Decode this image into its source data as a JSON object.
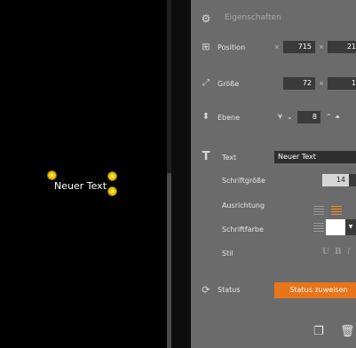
{
  "canvas": {
    "text_element": "Neuer Text"
  },
  "panel": {
    "title": "Eigenschaften",
    "position": {
      "label": "Position",
      "sep": "×",
      "x": "715",
      "y": "21"
    },
    "size": {
      "label": "Größe",
      "sep": "×",
      "w": "72",
      "h": "1"
    },
    "layer": {
      "label": "Ebene",
      "value": "8"
    },
    "text": {
      "label": "Text",
      "value": "Neuer Text",
      "font_size_label": "Schriftgröße",
      "font_size": "14",
      "align_label": "Ausrichtung",
      "color_label": "Schriftfarbe",
      "style_label": "Stil",
      "style_buttons": {
        "underline": "U",
        "bold": "B",
        "italic": "I"
      }
    },
    "status": {
      "label": "Status",
      "button": "Status zuweisen"
    }
  },
  "colors": {
    "accent": "#e8751a",
    "handle": "#f5c400",
    "panel_bg": "#6b6b6b",
    "active_align": "#ff8c1a"
  },
  "icons": [
    "gear-icon",
    "position-icon",
    "resize-icon",
    "layer-icon",
    "text-icon",
    "status-icon",
    "copy-icon",
    "trash-icon"
  ]
}
